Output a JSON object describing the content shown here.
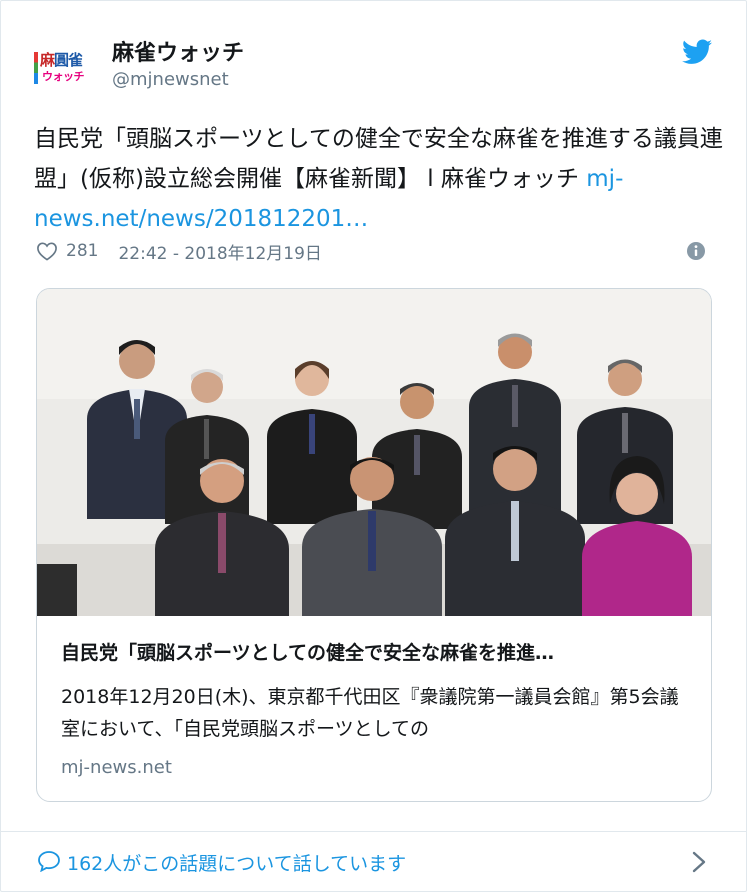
{
  "account": {
    "display_name": "麻雀ウォッチ",
    "handle": "@mjnewsnet",
    "logo_line1_a": "麻",
    "logo_line1_b": "雀",
    "logo_line2": "ウォッチ"
  },
  "tweet": {
    "text": "自民党「頭脳スポーツとしての健全で安全な麻雀を推進する議員連盟」(仮称)設立総会開催【麻雀新聞】 l 麻雀ウォッチ ",
    "link_text": "mj-news.net/news/201812201…",
    "likes": "281",
    "timestamp": "22:42 - 2018年12月19日"
  },
  "card": {
    "title": "自民党「頭脳スポーツとしての健全で安全な麻雀を推進…",
    "description": "2018年12月20日(木)、東京都千代田区『衆議院第一議員会館』第5会議室において、「自民党頭脳スポーツとしての",
    "domain": "mj-news.net"
  },
  "footer": {
    "talking_text": "162人がこの話題について話しています"
  },
  "colors": {
    "link_blue": "#1b95e0",
    "secondary_text": "#657786",
    "border": "#e1e8ed"
  },
  "icons": [
    "twitter-bird-icon",
    "heart-icon",
    "info-icon",
    "comment-icon",
    "chevron-right-icon"
  ]
}
